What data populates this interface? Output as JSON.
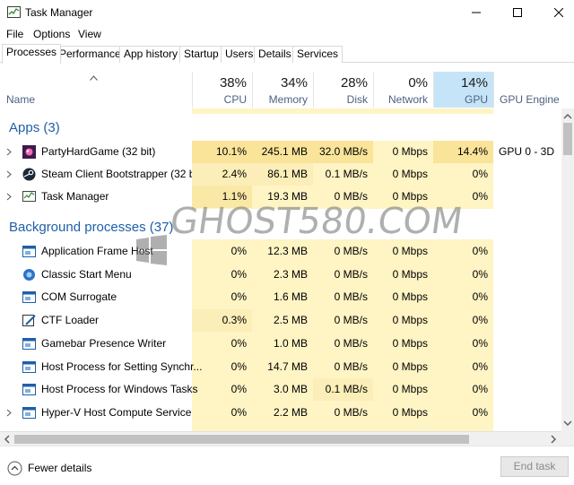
{
  "window": {
    "title": "Task Manager"
  },
  "menu": [
    "File",
    "Options",
    "View"
  ],
  "tabs": [
    "Processes",
    "Performance",
    "App history",
    "Startup",
    "Users",
    "Details",
    "Services"
  ],
  "header": {
    "name_label": "Name",
    "columns": [
      {
        "pct": "38%",
        "label": "CPU"
      },
      {
        "pct": "34%",
        "label": "Memory"
      },
      {
        "pct": "28%",
        "label": "Disk"
      },
      {
        "pct": "0%",
        "label": "Network"
      },
      {
        "pct": "14%",
        "label": "GPU"
      }
    ],
    "gpu_engine_label": "GPU Engine"
  },
  "groups": {
    "apps": "Apps (3)",
    "background": "Background processes (37)"
  },
  "apps": [
    {
      "name": "PartyHardGame (32 bit)",
      "cpu": "10.1%",
      "mem": "245.1 MB",
      "disk": "32.0 MB/s",
      "net": "0 Mbps",
      "gpu": "14.4%",
      "engine": "GPU 0 - 3D",
      "icon": "game-icon"
    },
    {
      "name": "Steam Client Bootstrapper (32 b...",
      "cpu": "2.4%",
      "mem": "86.1 MB",
      "disk": "0.1 MB/s",
      "net": "0 Mbps",
      "gpu": "0%",
      "engine": "",
      "icon": "steam-icon"
    },
    {
      "name": "Task Manager",
      "cpu": "1.1%",
      "mem": "19.3 MB",
      "disk": "0 MB/s",
      "net": "0 Mbps",
      "gpu": "0%",
      "engine": "",
      "icon": "task-manager-icon"
    }
  ],
  "background": [
    {
      "name": "Application Frame Host",
      "cpu": "0%",
      "mem": "12.3 MB",
      "disk": "0 MB/s",
      "net": "0 Mbps",
      "gpu": "0%",
      "icon": "window-icon"
    },
    {
      "name": "Classic Start Menu",
      "cpu": "0%",
      "mem": "2.3 MB",
      "disk": "0 MB/s",
      "net": "0 Mbps",
      "gpu": "0%",
      "icon": "start-menu-icon"
    },
    {
      "name": "COM Surrogate",
      "cpu": "0%",
      "mem": "1.6 MB",
      "disk": "0 MB/s",
      "net": "0 Mbps",
      "gpu": "0%",
      "icon": "window-icon"
    },
    {
      "name": "CTF Loader",
      "cpu": "0.3%",
      "mem": "2.5 MB",
      "disk": "0 MB/s",
      "net": "0 Mbps",
      "gpu": "0%",
      "icon": "pen-icon"
    },
    {
      "name": "Gamebar Presence Writer",
      "cpu": "0%",
      "mem": "1.0 MB",
      "disk": "0 MB/s",
      "net": "0 Mbps",
      "gpu": "0%",
      "icon": "window-icon"
    },
    {
      "name": "Host Process for Setting Synchr...",
      "cpu": "0%",
      "mem": "14.7 MB",
      "disk": "0 MB/s",
      "net": "0 Mbps",
      "gpu": "0%",
      "icon": "window-icon"
    },
    {
      "name": "Host Process for Windows Tasks",
      "cpu": "0%",
      "mem": "3.0 MB",
      "disk": "0.1 MB/s",
      "net": "0 Mbps",
      "gpu": "0%",
      "icon": "window-icon"
    },
    {
      "name": "Hyper-V Host Compute Service",
      "cpu": "0%",
      "mem": "2.2 MB",
      "disk": "0 MB/s",
      "net": "0 Mbps",
      "gpu": "0%",
      "icon": "window-icon"
    }
  ],
  "footer": {
    "fewer_details": "Fewer details",
    "end_task": "End task"
  },
  "watermark": "GHOST580.COM",
  "colors": {
    "highlight": "#f9e49a",
    "light_highlight": "#fff4c4",
    "group_text": "#1f5fa8",
    "header_text": "#4d6082",
    "gpu_header": "#c6e4f7"
  }
}
